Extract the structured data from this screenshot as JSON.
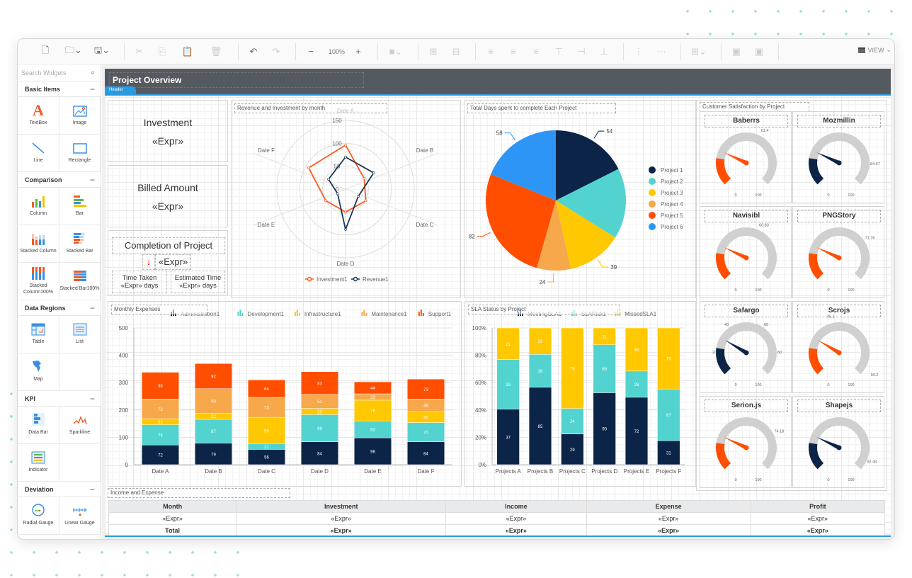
{
  "toolbar": {
    "items": [
      {
        "name": "new-file-icon",
        "glyph": "🗋",
        "enabled": true
      },
      {
        "name": "open-folder-icon",
        "glyph": "🗀⌄",
        "enabled": true
      },
      {
        "name": "save-icon",
        "glyph": "🖫⌄",
        "enabled": true
      },
      {
        "name": "cut-icon",
        "glyph": "✂",
        "enabled": false
      },
      {
        "name": "copy-icon",
        "glyph": "⎘",
        "enabled": false
      },
      {
        "name": "paste-icon",
        "glyph": "📋",
        "enabled": false
      },
      {
        "name": "delete-icon",
        "glyph": "🗑",
        "enabled": false
      },
      {
        "name": "undo-icon",
        "glyph": "↶",
        "enabled": true
      },
      {
        "name": "redo-icon",
        "glyph": "↷",
        "enabled": false
      }
    ],
    "zoom_out": "−",
    "zoom_level": "100%",
    "zoom_in": "+",
    "view_label": "VIEW"
  },
  "sidebar": {
    "search_placeholder": "Search Widgets",
    "categories": [
      {
        "name": "Basic Items",
        "collapse": "−",
        "items": [
          "TextBox",
          "Image",
          "Line",
          "Rectangle"
        ]
      },
      {
        "name": "Comparison",
        "collapse": "−",
        "items": [
          "Column",
          "Bar",
          "Stacked Column",
          "Stacked Bar",
          "Stacked Column100%",
          "Stacked Bar100%"
        ]
      },
      {
        "name": "Data Regions",
        "collapse": "−",
        "items": [
          "Table",
          "List",
          "Map"
        ]
      },
      {
        "name": "KPI",
        "collapse": "−",
        "items": [
          "Data Bar",
          "Sparkline",
          "Indicator"
        ]
      },
      {
        "name": "Deviation",
        "collapse": "−",
        "items": [
          "Radial Gauge",
          "Linear Gauge"
        ]
      }
    ]
  },
  "report": {
    "title": "Project Overview",
    "header_tab": "Header",
    "kpis": {
      "investment_label": "Investment",
      "investment_value": "«Expr»",
      "billed_label": "Billed Amount",
      "billed_value": "«Expr»",
      "completion_label": "Completion of Project",
      "completion_value": "«Expr»",
      "time_taken_label": "Time Taken",
      "time_taken_value": "«Expr» days",
      "estimated_label": "Estimated Time",
      "estimated_value": "«Expr» days"
    },
    "gauge_title": "Customer Satisfaction by Project",
    "gauges": [
      {
        "name": "Baberrs",
        "value": 61.4,
        "color": "#ff4e00",
        "min": "0",
        "max": "100",
        "label": "61.4"
      },
      {
        "name": "Mozmillin",
        "value": 84.67,
        "color": "#0b2447",
        "min": "0",
        "max": "100",
        "label": "84.67"
      },
      {
        "name": "Navisibl",
        "value": 60.83,
        "color": "#ff4e00",
        "min": "0",
        "max": "100",
        "label": "60.83"
      },
      {
        "name": "PNGStory",
        "value": 71.76,
        "color": "#ff4e00",
        "min": "0",
        "max": "100",
        "label": "71.76"
      },
      {
        "name": "Safargo",
        "value": 40,
        "color": "#0b2447",
        "min": "0",
        "max": "100",
        "ticks": [
          "20",
          "40",
          "60",
          "80"
        ]
      },
      {
        "name": "Scrojs",
        "value": 45.1,
        "color": "#ff4e00",
        "min": "0",
        "max": "100",
        "label": "45.1",
        "label2": "90.2"
      },
      {
        "name": "Serion.js",
        "value": 74.18,
        "color": "#ff4e00",
        "min": "0",
        "max": "100",
        "label": "74.18"
      },
      {
        "name": "Shapejs",
        "value": 92.48,
        "color": "#0b2447",
        "min": "0",
        "max": "100",
        "label": "92.48"
      }
    ],
    "table": {
      "title": "Income and Expense",
      "headers": [
        "Month",
        "Investment",
        "Income",
        "Expense",
        "Profit"
      ],
      "rows": [
        [
          "«Expr»",
          "«Expr»",
          "«Expr»",
          "«Expr»",
          "«Expr»"
        ]
      ],
      "total": [
        "Total",
        "«Expr»",
        "«Expr»",
        "«Expr»",
        "«Expr»"
      ]
    }
  },
  "chart_data": [
    {
      "type": "radar",
      "title": "Revenue and Investment by month",
      "categories": [
        "Date A",
        "Date B",
        "Date C",
        "Date D",
        "Date E",
        "Date F"
      ],
      "rticks": [
        "0",
        "50",
        "100",
        "150"
      ],
      "rlim": [
        0,
        150
      ],
      "series": [
        {
          "name": "Investment1",
          "color": "#ff5a1f",
          "values": [
            96,
            47,
            51,
            50,
            50,
            93
          ]
        },
        {
          "name": "Revenue1",
          "color": "#1d3557",
          "values": [
            70,
            71,
            32,
            88,
            20,
            43
          ]
        }
      ],
      "legend": "bottom"
    },
    {
      "type": "pie",
      "title": "Total Days spent to complete Each Project",
      "categories": [
        "Project 1",
        "Project 2",
        "Project 3",
        "Project 4",
        "Project 5",
        "Project 6"
      ],
      "values": [
        54,
        50,
        39,
        24,
        82,
        58
      ],
      "labels": [
        "54",
        "",
        "39",
        "24",
        "82",
        "58"
      ],
      "colors": [
        "#0b2447",
        "#52d3d0",
        "#ffc800",
        "#f7a84a",
        "#ff4e00",
        "#2d95f5"
      ],
      "legend": "right"
    },
    {
      "type": "bar",
      "stacked": true,
      "title": "Monthly Expenses",
      "categories": [
        "Date A",
        "Date B",
        "Date C",
        "Date D",
        "Date E",
        "Date F"
      ],
      "yticks": [
        "0",
        "100",
        "200",
        "300",
        "400",
        "500"
      ],
      "ylim": [
        0,
        500
      ],
      "series": [
        {
          "name": "Administration1",
          "color": "#0b2447",
          "values": [
            72,
            79,
            56,
            84,
            98,
            84
          ]
        },
        {
          "name": "Development1",
          "color": "#52d3d0",
          "values": [
            74,
            87,
            21,
            99,
            62,
            70
          ]
        },
        {
          "name": "Infrastructure1",
          "color": "#ffc800",
          "values": [
            22,
            22,
            96,
            23,
            76,
            40
          ]
        },
        {
          "name": "Maintenance1",
          "color": "#f7a84a",
          "values": [
            72,
            90,
            73,
            51,
            23,
            46
          ]
        },
        {
          "name": "Support1",
          "color": "#ff4e00",
          "values": [
            98,
            92,
            64,
            83,
            44,
            73
          ]
        }
      ],
      "legend": "top"
    },
    {
      "type": "bar",
      "stacked": "100%",
      "title": "SLA Status by Project",
      "categories": [
        "Projects A",
        "Projects B",
        "Projects C",
        "Projects D",
        "Projects E",
        "Projects F"
      ],
      "yticks": [
        "0%",
        "20%",
        "40%",
        "60%",
        "80%",
        "100%"
      ],
      "ylim": [
        0,
        100
      ],
      "series": [
        {
          "name": "MeetingSLA1",
          "color": "#0b2447",
          "values": [
            37,
            85,
            29,
            90,
            72,
            31
          ]
        },
        {
          "name": "SLARisk1",
          "color": "#52d3d0",
          "values": [
            33,
            36,
            24,
            60,
            28,
            67
          ]
        },
        {
          "name": "MissedSLA1",
          "color": "#ffc800",
          "values": [
            21,
            29,
            76,
            21,
            46,
            79
          ]
        }
      ],
      "legend": "top"
    }
  ]
}
